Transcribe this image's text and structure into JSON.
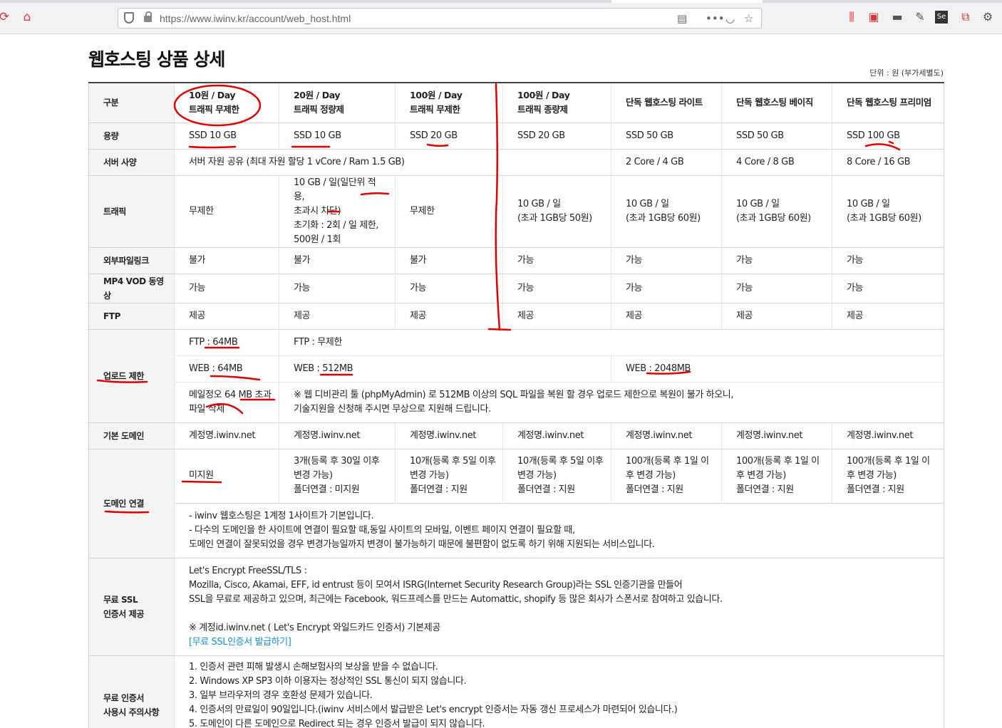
{
  "browser": {
    "url": "https://www.iwinv.kr/account/web_host.html",
    "icons": [
      "reload-icon",
      "home-icon",
      "shield-icon",
      "lock-icon",
      "reader-view-icon",
      "more-icon",
      "pocket-icon",
      "bookmark-star-icon",
      "library-icon",
      "sidebar-icon",
      "toolbar-extension-icon",
      "eyedropper-icon",
      "selenium-icon",
      "screenshot-icon",
      "settings-icon"
    ]
  },
  "page": {
    "title": "웹호스팅 상품 상세",
    "unit_note": "단위 : 원 (부가세별도)"
  },
  "table": {
    "corner": "구분",
    "columns": [
      {
        "line1": "10원 / Day",
        "line2": "트래픽 무제한"
      },
      {
        "line1": "20원 / Day",
        "line2": "트래픽 정량제"
      },
      {
        "line1": "100원 / Day",
        "line2": "트래픽 무제한"
      },
      {
        "line1": "100원 / Day",
        "line2": "트래픽 종량제"
      },
      {
        "line1": "단독 웹호스팅 라이트",
        "line2": ""
      },
      {
        "line1": "단독 웹호스팅 베이직",
        "line2": ""
      },
      {
        "line1": "단독 웹호스팅 프리미엄",
        "line2": ""
      }
    ],
    "capacity": {
      "label": "용량",
      "values": [
        "SSD 10 GB",
        "SSD 10 GB",
        "SSD 20 GB",
        "SSD 20 GB",
        "SSD 50 GB",
        "SSD 50 GB",
        "SSD 100 GB"
      ]
    },
    "server_spec": {
      "label": "서버 사양",
      "shared": "서버 자원 공유 (최대 자원 할당 1 vCore / Ram 1.5 GB)",
      "values": [
        "2 Core / 4 GB",
        "4 Core / 8 GB",
        "8 Core / 16 GB"
      ]
    },
    "traffic": {
      "label": "트래픽",
      "col1": "무제한",
      "col2": [
        "10 GB / 일(일단위 적용,",
        "초과시 차단)",
        "초기화 : 2회 / 일 제한,",
        "500원 / 1회"
      ],
      "col3": "무제한",
      "col4": [
        "10 GB / 일",
        "(초과 1GB당 50원)"
      ],
      "col5": [
        "10 GB / 일",
        "(초과 1GB당 60원)"
      ],
      "col6": [
        "10 GB / 일",
        "(초과 1GB당 60원)"
      ],
      "col7": [
        "10 GB / 일",
        "(초과 1GB당 60원)"
      ]
    },
    "external_link": {
      "label": "외부파일링크",
      "values": [
        "불가",
        "불가",
        "불가",
        "가능",
        "가능",
        "가능",
        "가능"
      ]
    },
    "mp4_vod": {
      "label": "MP4 VOD 동영상",
      "values": [
        "가능",
        "가능",
        "가능",
        "가능",
        "가능",
        "가능",
        "가능"
      ]
    },
    "ftp": {
      "label": "FTP",
      "values": [
        "제공",
        "제공",
        "제공",
        "제공",
        "제공",
        "제공",
        "제공"
      ]
    },
    "upload_limit": {
      "label": "업로드 제한",
      "ftp_first": "FTP : 64MB",
      "ftp_rest": "FTP : 무제한",
      "web_first": "WEB : 64MB",
      "web_mid": "WEB : 512MB",
      "web_last": "WEB : 2048MB",
      "mail_note": [
        "메일정오 64 MB 초과",
        "파일 삭제"
      ],
      "sql_note": [
        "※ 웹 디비관리 툴 (phpMyAdmin) 로 512MB 이상의 SQL 파일을 복원 할 경우 업로드 제한으로 복원이 불가 하오니,",
        "기술지원을 신청해 주시면 무상으로 지원해 드립니다."
      ]
    },
    "default_domain": {
      "label": "기본 도메인",
      "values": [
        "계정명.iwinv.net",
        "계정명.iwinv.net",
        "계정명.iwinv.net",
        "계정명.iwinv.net",
        "계정명.iwinv.net",
        "계정명.iwinv.net",
        "계정명.iwinv.net"
      ]
    },
    "domain_link": {
      "label": "도메인 연결",
      "col1": "미지원",
      "col2": [
        "3개(등록 후 30일 이후",
        "변경 가능)",
        "폴더연결 : 미지원"
      ],
      "col3": [
        "10개(등록 후 5일 이후",
        "변경 가능)",
        "폴더연결 : 지원"
      ],
      "col4": [
        "10개(등록 후 5일 이후",
        "변경 가능)",
        "폴더연결 : 지원"
      ],
      "col5": [
        "100개(등록 후 1일 이",
        "후 변경 가능)",
        "폴더연결 : 지원"
      ],
      "col6": [
        "100개(등록 후 1일 이",
        "후 변경 가능)",
        "폴더연결 : 지원"
      ],
      "col7": [
        "100개(등록 후 1일 이",
        "후 변경 가능)",
        "폴더연결 : 지원"
      ],
      "note": [
        "- iwinv 웹호스팅은 1계정 1사이트가 기본입니다.",
        "- 다수의 도메인을 한 사이트에 연결이 필요할 때,동일 사이트의 모바일, 이벤트 페이지 연결이 필요할 때,",
        "도메인 연결이 잘못되었을 경우 변경가능일까지 변경이 불가능하기 때문에 불편함이 없도록 하기 위해 지원되는 서비스입니다."
      ]
    },
    "free_ssl": {
      "label": [
        "무료 SSL",
        "인증서 제공"
      ],
      "lines": [
        "Let's Encrypt FreeSSL/TLS :",
        "Mozilla, Cisco, Akamai, EFF, id entrust 등이 모여서 ISRG(Internet Security Research Group)라는 SSL 인증기관을 만들어",
        "SSL을 무료로 제공하고 있으며, 최근에는 Facebook, 워드프레스를 만드는 Automattic, shopify 등 많은 회사가 스폰서로 참여하고 있습니다."
      ],
      "wildcard": "※ 계정id.iwinv.net ( Let's Encrypt 와일드카드 인증서) 기본제공",
      "issue_link": "[무료 SSL인증서 발급하기]"
    },
    "ssl_caution": {
      "label": [
        "무료 인증서",
        "사용시 주의사항"
      ],
      "lines": [
        "1. 인증서 관련 피해 발생시 손해보험사의 보상을 받을 수 없습니다.",
        "2. Windows XP SP3 이하 이용자는 정상적인 SSL 통신이 되지 않습니다.",
        "3. 일부 브라우저의 경우 호환성 문제가 있습니다.",
        "4. 인증서의 만료일이 90일입니다.(iwinv 서비스에서 발급받은 Let's encrypt 인증서는 자동 갱신 프로세스가 마련되어 있습니다.)",
        "5. 도메인이 다른 도메인으로 Redirect 되는 경우 인증서 발급이 되지 않습니다."
      ]
    }
  },
  "annotation_color": "#e00000"
}
